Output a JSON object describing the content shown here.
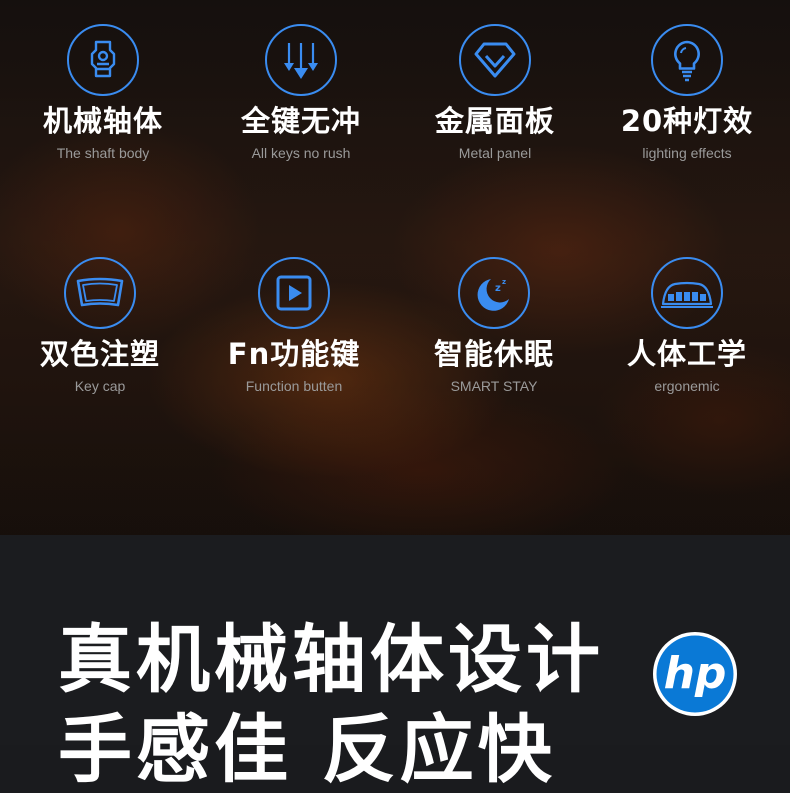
{
  "features": [
    {
      "title": "机械轴体",
      "subtitle": "The shaft body",
      "icon": "switch-icon"
    },
    {
      "title": "全键无冲",
      "subtitle": "All keys no rush",
      "icon": "down-arrows-icon"
    },
    {
      "title": "金属面板",
      "subtitle": "Metal panel",
      "icon": "diamond-icon"
    },
    {
      "title": "20种灯效",
      "subtitle": "lighting effects",
      "icon": "bulb-icon"
    },
    {
      "title": "双色注塑",
      "subtitle": "Key cap",
      "icon": "keycap-icon"
    },
    {
      "title": "Fn功能键",
      "subtitle": "Function butten",
      "icon": "play-button-icon"
    },
    {
      "title": "智能休眠",
      "subtitle": "SMART STAY",
      "icon": "moon-sleep-icon"
    },
    {
      "title": "人体工学",
      "subtitle": "ergonemic",
      "icon": "keyboard-icon"
    }
  ],
  "banner": {
    "headline_line1": "真机械轴体设计",
    "headline_line2": "手感佳 反应快",
    "logo_text": "hp"
  },
  "colors": {
    "accent": "#3a8cf0",
    "logo_blue": "#0a79d6"
  }
}
